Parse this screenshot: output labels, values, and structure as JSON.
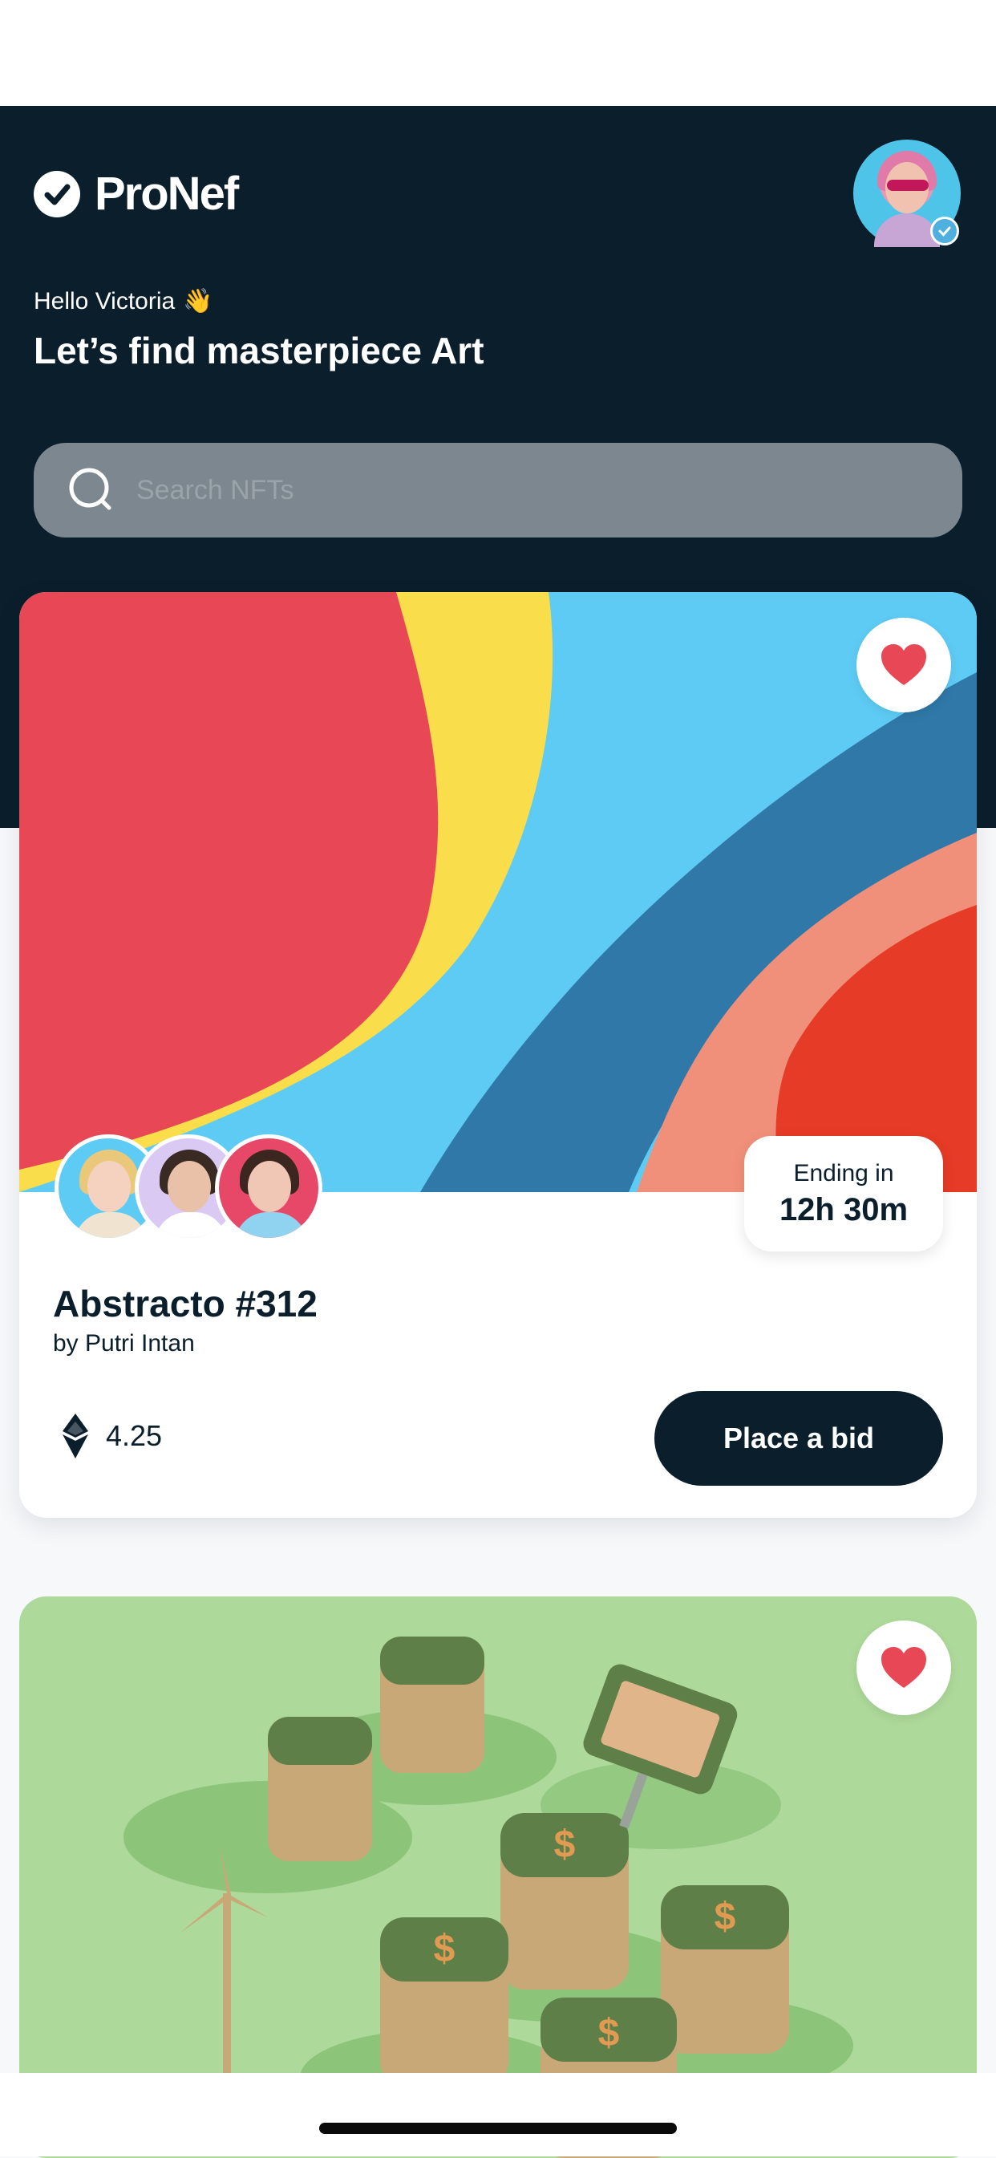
{
  "app": {
    "name": "ProNef"
  },
  "header": {
    "greeting": "Hello Victoria",
    "greeting_emoji": "👋",
    "title": "Let’s find masterpiece Art"
  },
  "search": {
    "placeholder": "Search NFTs",
    "icon": "search-icon"
  },
  "cards": [
    {
      "favorite": true,
      "ending_label": "Ending in",
      "ending_value": "12h 30m",
      "title": "Abstracto #312",
      "artist": "by Putri Intan",
      "price": "4.25",
      "currency_icon": "ethereum-icon",
      "bid_label": "Place a bid",
      "bidder_count": 3
    },
    {
      "favorite": true
    }
  ],
  "colors": {
    "hero_bg": "#0a1e2b",
    "search_bg": "#7c878f",
    "accent_red": "#e84855",
    "button_bg": "#0a1e2b"
  }
}
